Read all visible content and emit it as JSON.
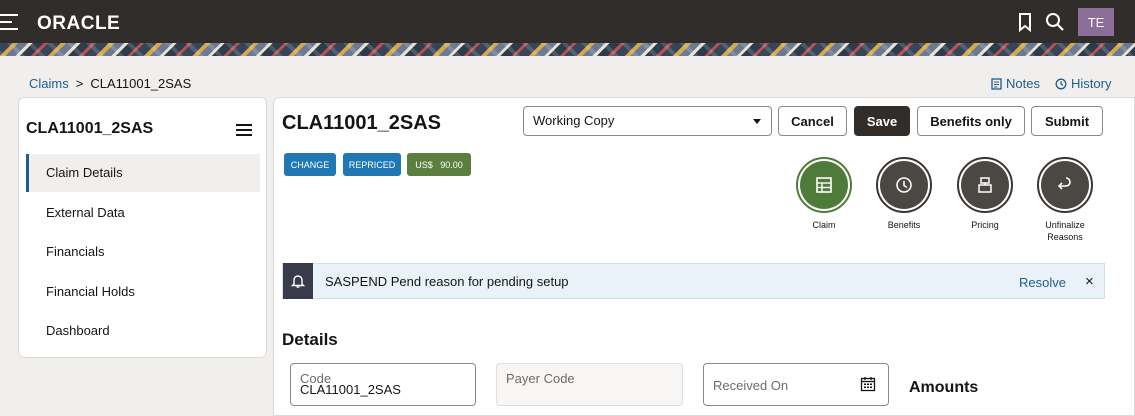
{
  "header": {
    "brand": "ORACLE",
    "user_initials": "TE"
  },
  "breadcrumb": {
    "parent": "Claims",
    "separator": ">",
    "current": "CLA11001_2SAS"
  },
  "links": {
    "notes": "Notes",
    "history": "History"
  },
  "sidebar": {
    "title": "CLA11001_2SAS",
    "items": [
      {
        "label": "Claim Details",
        "active": true
      },
      {
        "label": "External Data"
      },
      {
        "label": "Financials"
      },
      {
        "label": "Financial Holds"
      },
      {
        "label": "Dashboard"
      }
    ]
  },
  "main": {
    "title": "CLA11001_2SAS",
    "version_select": "Working Copy",
    "buttons": {
      "cancel": "Cancel",
      "save": "Save",
      "benefits_only": "Benefits only",
      "submit": "Submit"
    },
    "badges": [
      {
        "label": "CHANGE",
        "color": "#1f78b4"
      },
      {
        "label": "REPRICED",
        "color": "#1f78b4"
      },
      {
        "label": "US$   90.00",
        "color": "#5a7f3e"
      }
    ],
    "actions": [
      {
        "label": "Claim",
        "icon": "table-icon"
      },
      {
        "label": "Benefits",
        "icon": "clock-icon"
      },
      {
        "label": "Pricing",
        "icon": "cash-register-icon"
      },
      {
        "label": "Unfinalize Reasons",
        "icon": "undo-icon"
      }
    ],
    "alert": {
      "message": "SASPEND Pend reason for pending setup",
      "action": "Resolve",
      "close": "×"
    },
    "details_heading": "Details",
    "fields": {
      "code": {
        "label": "Code",
        "value": "CLA11001_2SAS"
      },
      "payer_code": {
        "label": "Payer Code",
        "value": ""
      },
      "received_on": {
        "label": "Received On",
        "value": ""
      }
    },
    "amounts_heading": "Amounts"
  }
}
